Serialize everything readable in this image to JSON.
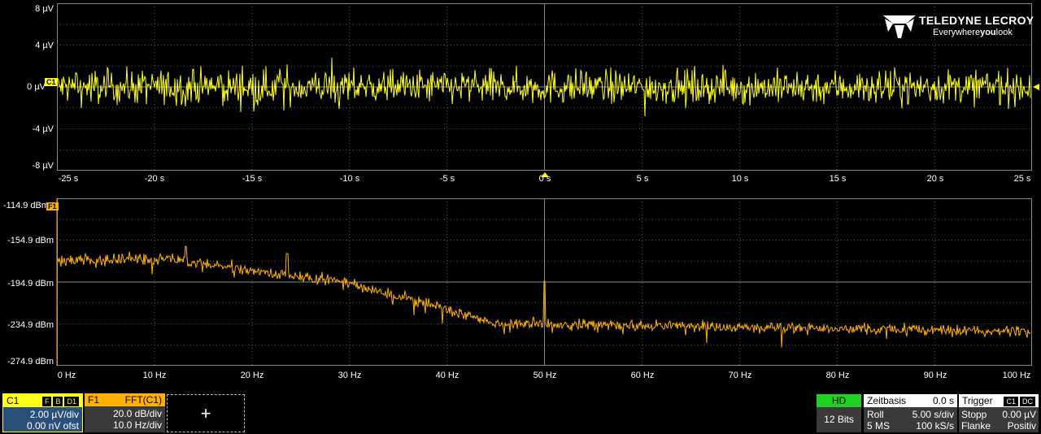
{
  "top_plot": {
    "y_labels": [
      "8 µV",
      "4 µV",
      "0 µV",
      "-4 µV",
      "-8 µV"
    ],
    "x_labels": [
      "-25 s",
      "-20 s",
      "-15 s",
      "-10 s",
      "-5 s",
      "0 s",
      "5 s",
      "10 s",
      "15 s",
      "20 s",
      "25 s"
    ],
    "channel_marker": "C1",
    "trace_color": "#ffff1a"
  },
  "bottom_plot": {
    "y_labels": [
      "-114.9 dBm",
      "-154.9 dBm",
      "-194.9 dBm",
      "-234.9 dBm",
      "-274.9 dBm"
    ],
    "x_labels": [
      "0 Hz",
      "10 Hz",
      "20 Hz",
      "30 Hz",
      "40 Hz",
      "50 Hz",
      "60 Hz",
      "70 Hz",
      "80 Hz",
      "90 Hz",
      "100 Hz"
    ],
    "channel_marker": "F1",
    "trace_color": "#ffb000"
  },
  "brand": {
    "name": "TELEDYNE LECROY",
    "tagline_a": "Everywhere",
    "tagline_b": "you",
    "tagline_c": "look"
  },
  "c1_box": {
    "name": "C1",
    "tags": [
      "F",
      "B",
      "D1"
    ],
    "vdiv": "2.00 µV/div",
    "offset": "0.00 nV ofst",
    "color": "#ffff1a"
  },
  "f1_box": {
    "name": "F1",
    "func": "FFT(C1)",
    "vdiv": "20.0 dB/div",
    "hdiv": "10.0 Hz/div",
    "color": "#ffb000"
  },
  "add_button": "+",
  "hd_box": {
    "label": "HD",
    "bits": "12 Bits"
  },
  "timebase": {
    "title": "Zeitbasis",
    "delay": "0.0 s",
    "mode": "Roll",
    "tdiv": "5.00 s/div",
    "samples": "5 MS",
    "rate": "100 kS/s"
  },
  "trigger": {
    "title": "Trigger",
    "tag1": "C1",
    "tag2": "DC",
    "state": "Stopp",
    "level": "0.00 µV",
    "type": "Flanke",
    "slope": "Positiv"
  }
}
